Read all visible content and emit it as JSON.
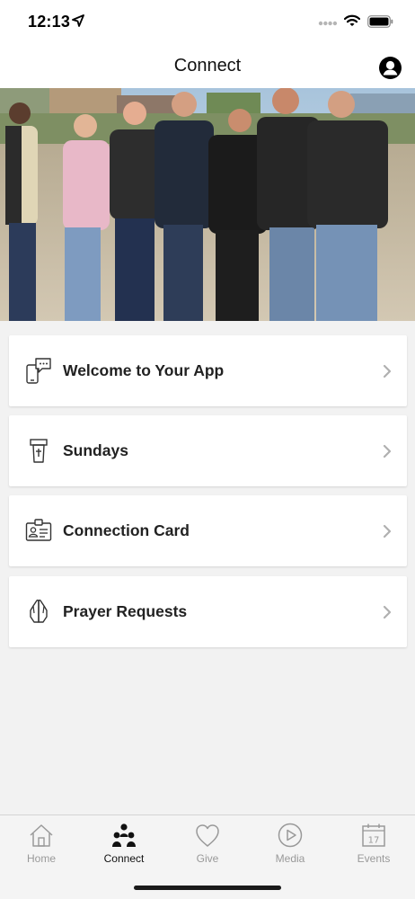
{
  "status_bar": {
    "time": "12:13"
  },
  "header": {
    "title": "Connect"
  },
  "menu": [
    {
      "label": "Welcome to Your App",
      "icon": "phone-chat-icon"
    },
    {
      "label": "Sundays",
      "icon": "pulpit-icon"
    },
    {
      "label": "Connection Card",
      "icon": "id-card-icon"
    },
    {
      "label": "Prayer Requests",
      "icon": "praying-hands-icon"
    }
  ],
  "tabs": [
    {
      "label": "Home",
      "icon": "home-icon"
    },
    {
      "label": "Connect",
      "icon": "people-icon"
    },
    {
      "label": "Give",
      "icon": "heart-icon"
    },
    {
      "label": "Media",
      "icon": "play-icon"
    },
    {
      "label": "Events",
      "icon": "calendar-icon",
      "calendar_day": "17"
    }
  ],
  "active_tab": "Connect",
  "colors": {
    "accent": "#111111",
    "inactive": "#999999",
    "background": "#f2f2f2"
  }
}
